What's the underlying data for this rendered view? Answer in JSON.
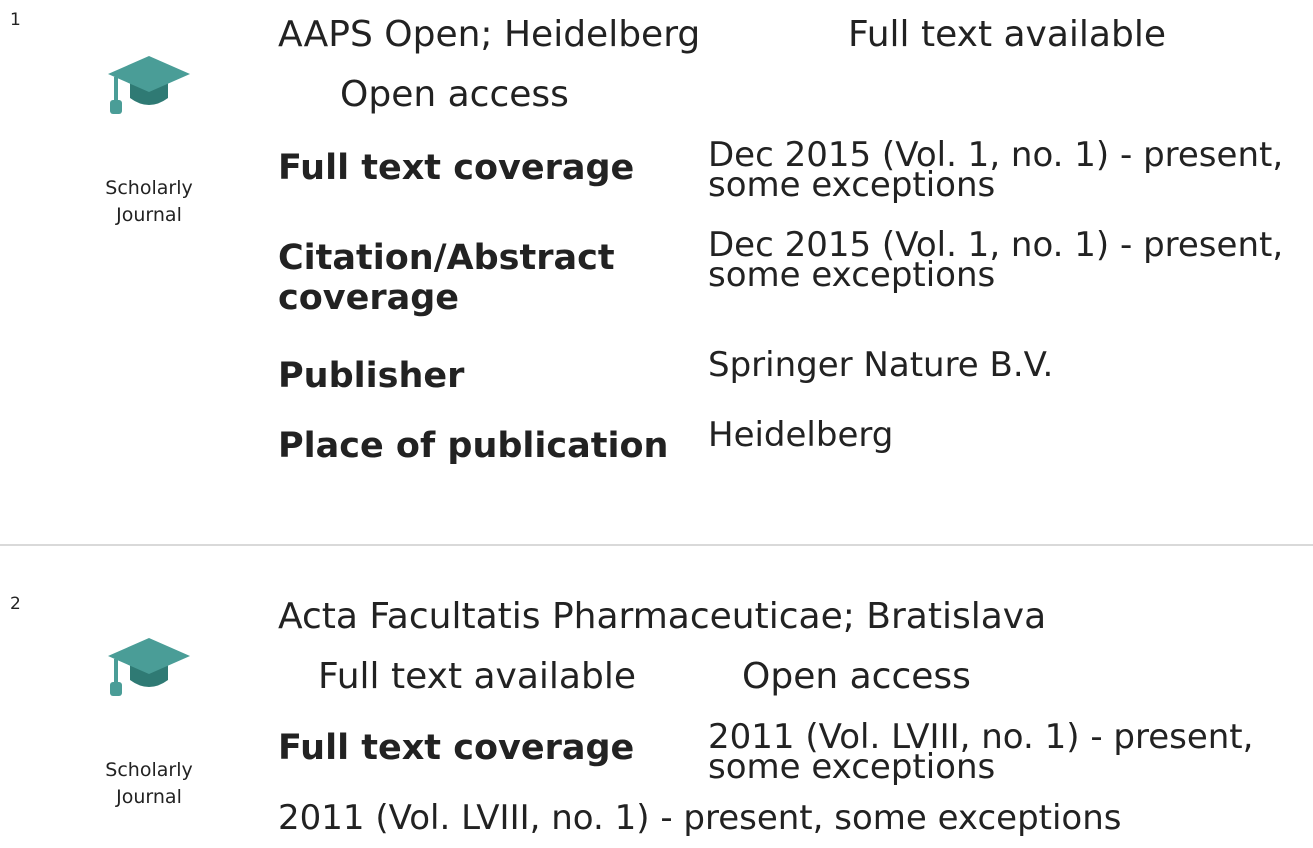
{
  "records": [
    {
      "index": "1",
      "source_type": "Scholarly Journal",
      "icon": "graduation-cap-icon",
      "title": "AAPS Open; Heidelberg",
      "badges": [
        "Full text available",
        "Open access"
      ],
      "fields": [
        {
          "label": "Full text coverage",
          "value": "Dec 2015 (Vol. 1, no. 1) - present, some exceptions"
        },
        {
          "label": "Citation/Abstract coverage",
          "value": "Dec 2015 (Vol. 1, no. 1) - present, some exceptions"
        },
        {
          "label": "Publisher",
          "value": "Springer Nature B.V."
        },
        {
          "label": "Place of publication",
          "value": "Heidelberg"
        }
      ]
    },
    {
      "index": "2",
      "source_type": "Scholarly Journal",
      "icon": "graduation-cap-icon",
      "title": "Acta Facultatis Pharmaceuticae; Bratislava",
      "badges": [
        "Full text available",
        "Open access"
      ],
      "fields": [
        {
          "label": "Full text coverage",
          "value": "2011 (Vol. LVIII, no. 1) - present, some exceptions"
        }
      ],
      "trailing_text": "2011 (Vol. LVIII, no. 1) - present, some exceptions"
    }
  ],
  "colors": {
    "icon_teal": "#4a9d97",
    "icon_dark": "#2f7a74",
    "divider": "#d9d9d9"
  }
}
